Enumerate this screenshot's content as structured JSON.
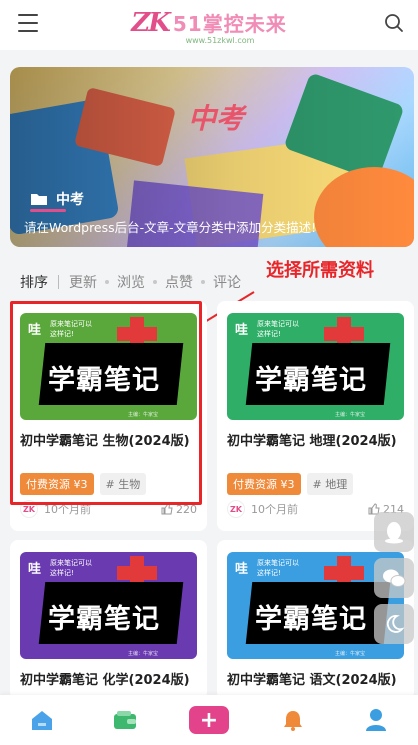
{
  "header": {
    "logo_mark": "ZK",
    "logo_text": "51掌控未来",
    "logo_url": "www.51zkwl.com"
  },
  "banner": {
    "logo": "中考",
    "category": "中考",
    "description": "请在Wordpress后台-文章-文章分类中添加分类描述!"
  },
  "filters": {
    "sort_label": "排序",
    "items": [
      "更新",
      "浏览",
      "点赞",
      "评论"
    ]
  },
  "annotation": {
    "text": "选择所需资料"
  },
  "cards": [
    {
      "thumb_top": "哇",
      "thumb_sub": "原来笔记可以\n这样记!",
      "thumb_big": "学霸笔记",
      "thumb_credit": "主编：牛家宝",
      "title": "初中学霸笔记 生物(2024版)",
      "tag_pay": "付费资源 ¥3",
      "tag_sub": "# 生物",
      "time": "10个月前",
      "likes": "220",
      "color": "#5aa83c"
    },
    {
      "thumb_top": "哇",
      "thumb_sub": "原来笔记可以\n这样记!",
      "thumb_big": "学霸笔记",
      "thumb_credit": "主编：牛家宝",
      "title": "初中学霸笔记 地理(2024版)",
      "tag_pay": "付费资源 ¥3",
      "tag_sub": "# 地理",
      "time": "10个月前",
      "likes": "214",
      "color": "#2fae68"
    },
    {
      "thumb_top": "哇",
      "thumb_sub": "原来笔记可以\n这样记!",
      "thumb_big": "学霸笔记",
      "thumb_credit": "主编：牛家宝",
      "title": "初中学霸笔记 化学(2024版)",
      "color": "#6a3ab0"
    },
    {
      "thumb_top": "哇",
      "thumb_sub": "原来笔记可以\n这样记!",
      "thumb_big": "学霸笔记",
      "thumb_credit": "主编：牛家宝",
      "title": "初中学霸笔记 语文(2024版)",
      "color": "#3a9ee0"
    }
  ],
  "bottom_nav": {
    "plus": "+"
  },
  "colors": {
    "brand": "#e2438a",
    "pay_tag": "#f08a3b",
    "annotation": "#e8262a"
  }
}
